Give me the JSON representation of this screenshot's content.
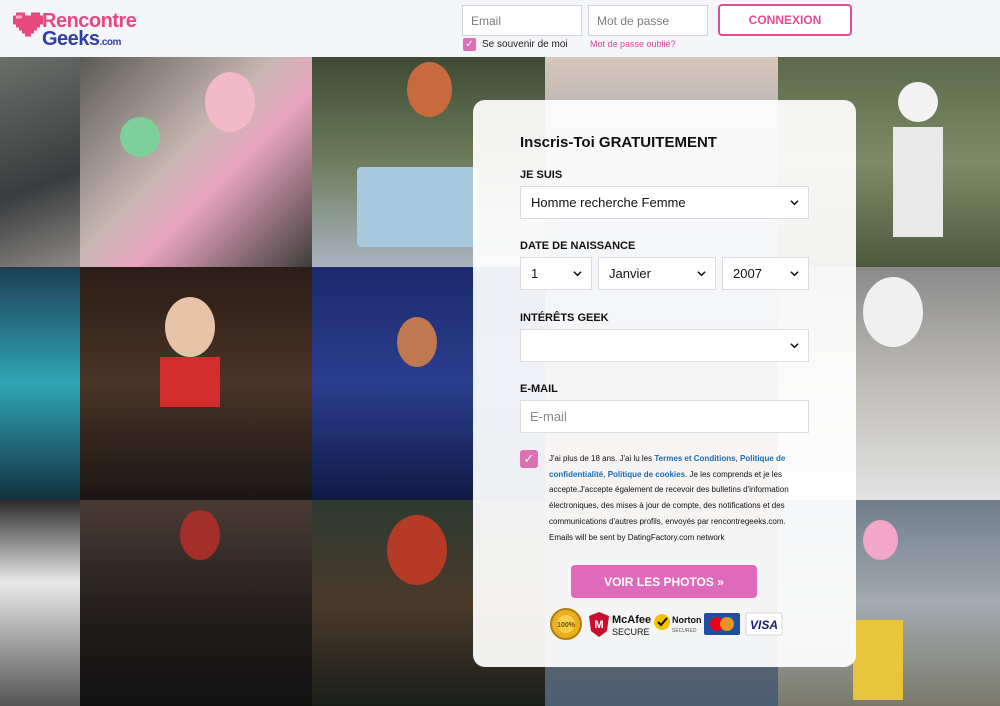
{
  "brand": {
    "line1": "Rencontre",
    "line2": "Geeks",
    "tld": ".com"
  },
  "header": {
    "email_placeholder": "Email",
    "password_placeholder": "Mot de passe",
    "login_label": "CONNEXION",
    "remember_label": "Se souvenir de moi",
    "forgot_label": "Mot de passe oublié?"
  },
  "form": {
    "title": "Inscris-Toi GRATUITEMENT",
    "je_suis_label": "JE SUIS",
    "je_suis_value": "Homme recherche Femme",
    "dob_label": "DATE DE NAISSANCE",
    "dob_day": "1",
    "dob_month": "Janvier",
    "dob_year": "2007",
    "interests_label": "INTÉRÊTS GEEK",
    "interests_value": "",
    "email_label": "E-MAIL",
    "email_placeholder": "E-mail",
    "terms_text_1": "J'ai plus de 18 ans. J'ai lu les ",
    "terms_link_1": "Termes et Conditions",
    "terms_sep_1": ", ",
    "terms_link_2": "Politique de confidentialité",
    "terms_sep_2": ", ",
    "terms_link_3": "Politique de cookies",
    "terms_text_2": ". Je les comprends et je les accepte.J'accepte également de recevoir des bulletins d'information électroniques, des mises à jour de compte, des notifications et des communications d'autres profils, envoyés par rencontregeeks.com. Emails will be sent by DatingFactory.com network",
    "cta_label": "VOIR LES PHOTOS »"
  },
  "badges": {
    "mcafee": "McAfee",
    "mcafee_sub": "SECURE",
    "norton": "Norton",
    "norton_sub": "SECURED",
    "visa": "VISA"
  },
  "colors": {
    "pink": "#e04c9a",
    "cta": "#e06aba",
    "brand_blue": "#2f3fa8",
    "link": "#1c6db3"
  }
}
